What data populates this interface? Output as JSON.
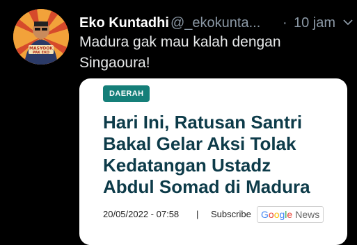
{
  "tweet": {
    "author_name": "Eko Kuntadhi",
    "handle": "@_ekokunta...",
    "separator": "·",
    "time": "10 jam",
    "text_lines": [
      "Madura gak mau kalah dengan",
      "Singaoura!"
    ],
    "avatar_text": [
      "MASYOOK",
      "PAK EKO"
    ]
  },
  "card": {
    "category": "DAERAH",
    "headline_lines": [
      "Hari Ini, Ratusan Santri",
      "Bakal Gelar Aksi Tolak",
      "Kedatangan Ustadz",
      "Abdul Somad di Madura"
    ],
    "date": "20/05/2022 - 07:58",
    "separator": "|",
    "subscribe_label": "Subscribe",
    "google_news": {
      "google": [
        "G",
        "o",
        "o",
        "g",
        "l",
        "e"
      ],
      "news": "News"
    }
  },
  "colors": {
    "background": "#000000",
    "badge": "#157f79",
    "headline": "#0d3b49"
  }
}
